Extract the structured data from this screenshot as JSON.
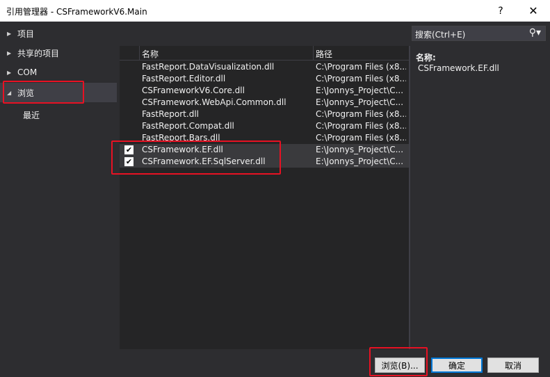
{
  "window": {
    "title": "引用管理器 - CSFrameworkV6.Main",
    "help_label": "?",
    "close_label": "✕"
  },
  "nav": {
    "items": [
      {
        "label": "项目",
        "arrow": "▶",
        "expanded": false
      },
      {
        "label": "共享的项目",
        "arrow": "▶",
        "expanded": false
      },
      {
        "label": "COM",
        "arrow": "▶",
        "expanded": false
      },
      {
        "label": "浏览",
        "arrow": "◢",
        "expanded": true,
        "selected": true
      },
      {
        "label": "最近",
        "sub": true
      }
    ]
  },
  "grid": {
    "columns": {
      "name": "名称",
      "path": "路径"
    },
    "rows": [
      {
        "name": "FastReport.DataVisualization.dll",
        "path": "C:\\Program Files (x8...",
        "checked": false
      },
      {
        "name": "FastReport.Editor.dll",
        "path": "C:\\Program Files (x8...",
        "checked": false
      },
      {
        "name": "CSFrameworkV6.Core.dll",
        "path": "E:\\Jonnys_Project\\C...",
        "checked": false
      },
      {
        "name": "CSFramework.WebApi.Common.dll",
        "path": "E:\\Jonnys_Project\\C...",
        "checked": false
      },
      {
        "name": "FastReport.dll",
        "path": "C:\\Program Files (x8...",
        "checked": false
      },
      {
        "name": "FastReport.Compat.dll",
        "path": "C:\\Program Files (x8...",
        "checked": false
      },
      {
        "name": "FastReport.Bars.dll",
        "path": "C:\\Program Files (x8...",
        "checked": false
      },
      {
        "name": "CSFramework.EF.dll",
        "path": "E:\\Jonnys_Project\\C...",
        "checked": true
      },
      {
        "name": "CSFramework.EF.SqlServer.dll",
        "path": "E:\\Jonnys_Project\\C...",
        "checked": true
      }
    ]
  },
  "search": {
    "placeholder": "搜索(Ctrl+E)",
    "icon": "search-icon"
  },
  "details": {
    "name_label": "名称:",
    "name_value": "CSFramework.EF.dll"
  },
  "buttons": {
    "browse": "浏览(B)...",
    "ok": "确定",
    "cancel": "取消"
  },
  "colors": {
    "highlight": "#e81123",
    "background": "#2d2d30",
    "list_background": "#252526",
    "focus_border": "#0078d7"
  }
}
